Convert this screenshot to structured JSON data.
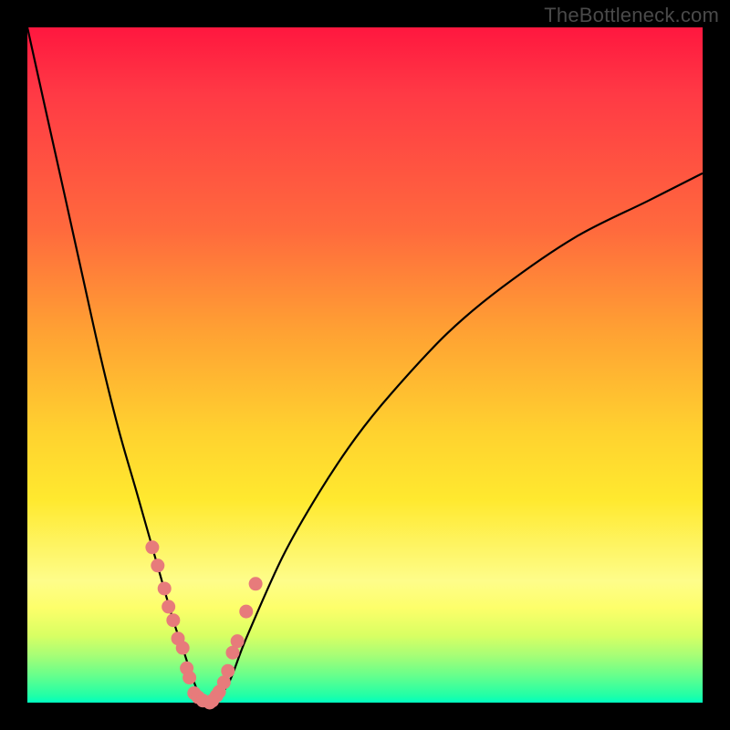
{
  "watermark": "TheBottleneck.com",
  "chart_data": {
    "type": "line",
    "title": "",
    "xlabel": "",
    "ylabel": "",
    "xlim": [
      0,
      100
    ],
    "ylim": [
      0,
      100
    ],
    "grid": false,
    "legend": false,
    "series": [
      {
        "name": "bottleneck-curve",
        "color": "#000000",
        "x": [
          0,
          2.7,
          5.4,
          8.1,
          10.8,
          13.5,
          16.2,
          18.9,
          21.6,
          23.0,
          24.3,
          25.7,
          27.0,
          29.7,
          32.4,
          37.8,
          43.2,
          48.6,
          54.0,
          62.2,
          70.3,
          81.1,
          91.9,
          100.0
        ],
        "y": [
          100.0,
          87.8,
          75.7,
          63.5,
          51.4,
          40.5,
          31.1,
          21.6,
          12.2,
          8.1,
          4.1,
          0.7,
          0.0,
          2.7,
          9.5,
          21.6,
          31.1,
          39.2,
          45.9,
          54.7,
          61.5,
          68.9,
          74.3,
          78.4
        ]
      },
      {
        "name": "marker-dots",
        "color": "#e77b7b",
        "type": "scatter",
        "x": [
          18.5,
          19.3,
          20.3,
          20.9,
          21.6,
          22.3,
          23.0,
          23.6,
          24.0,
          24.7,
          25.3,
          26.0,
          27.0,
          27.4,
          28.0,
          28.4,
          29.1,
          29.7,
          30.4,
          31.1,
          32.4,
          33.8
        ],
        "y": [
          23.0,
          20.3,
          16.9,
          14.2,
          12.2,
          9.5,
          8.1,
          5.1,
          3.7,
          1.4,
          0.8,
          0.3,
          0.0,
          0.3,
          1.0,
          1.6,
          3.0,
          4.7,
          7.4,
          9.1,
          13.5,
          17.6
        ]
      }
    ]
  }
}
